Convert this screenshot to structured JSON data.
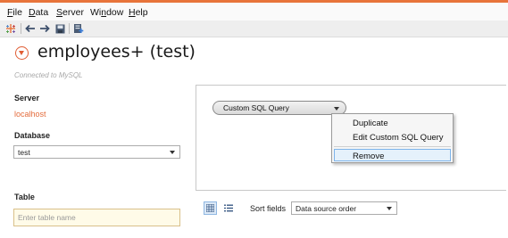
{
  "colors": {
    "accent": "#e46c3c",
    "selection": "#e5f1fb"
  },
  "menubar": {
    "items": [
      {
        "first": "F",
        "rest": "ile"
      },
      {
        "first": "D",
        "rest": "ata"
      },
      {
        "first": "S",
        "rest": "erver"
      },
      {
        "pre": "Wi",
        "first": "n",
        "rest": "dow"
      },
      {
        "first": "H",
        "rest": "elp"
      }
    ]
  },
  "toolbar": {
    "icons": [
      "tableau-logo-icon",
      "back-arrow-icon",
      "forward-arrow-icon",
      "save-icon",
      "new-data-source-icon"
    ]
  },
  "header": {
    "title": "employees+ (test)",
    "connected": "Connected to MySQL"
  },
  "sidebar": {
    "server_label": "Server",
    "server_value": "localhost",
    "database_label": "Database",
    "database_value": "test",
    "table_label": "Table",
    "table_placeholder": "Enter table name"
  },
  "canvas": {
    "pill_label": "Custom SQL Query"
  },
  "context_menu": {
    "items": [
      "Duplicate",
      "Edit Custom SQL Query",
      "Remove"
    ],
    "highlighted": "Remove"
  },
  "bottom": {
    "sort_label": "Sort fields",
    "sort_value": "Data source order"
  }
}
